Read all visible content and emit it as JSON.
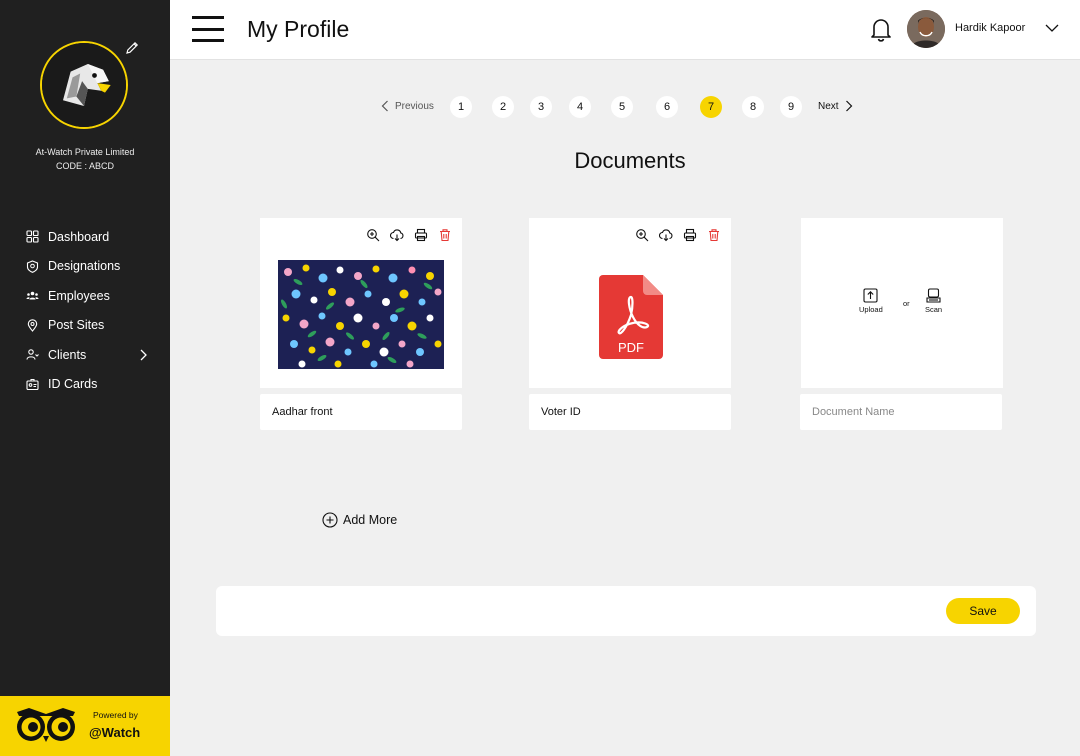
{
  "sidebar": {
    "company_name": "At-Watch Private Limited",
    "company_code": "CODE : ABCD",
    "items": [
      {
        "label": "Dashboard",
        "icon": "grid-icon"
      },
      {
        "label": "Designations",
        "icon": "badge-icon"
      },
      {
        "label": "Employees",
        "icon": "users-icon"
      },
      {
        "label": "Post Sites",
        "icon": "location-pin-icon"
      },
      {
        "label": "Clients",
        "icon": "client-icon",
        "has_submenu": true
      },
      {
        "label": "ID Cards",
        "icon": "id-card-icon"
      }
    ],
    "powered_by": "Powered by",
    "brand": "@Watch"
  },
  "header": {
    "title": "My Profile",
    "user_name": "Hardik Kapoor"
  },
  "pagination": {
    "previous_label": "Previous",
    "next_label": "Next",
    "pages": [
      "1",
      "2",
      "3",
      "4",
      "5",
      "6",
      "7",
      "8",
      "9"
    ],
    "current": "7"
  },
  "documents": {
    "title": "Documents",
    "cards": [
      {
        "name": "Aadhar front",
        "type": "image"
      },
      {
        "name": "Voter ID",
        "type": "pdf",
        "pdf_label": "PDF"
      },
      {
        "name": "",
        "placeholder": "Document Name",
        "type": "upload"
      }
    ],
    "upload_label": "Upload",
    "or_label": "or",
    "scan_label": "Scan",
    "add_more_label": "Add More"
  },
  "save_label": "Save",
  "colors": {
    "accent": "#f7d400",
    "sidebar": "#202020",
    "delete": "#e53935",
    "pdf": "#e53935"
  }
}
